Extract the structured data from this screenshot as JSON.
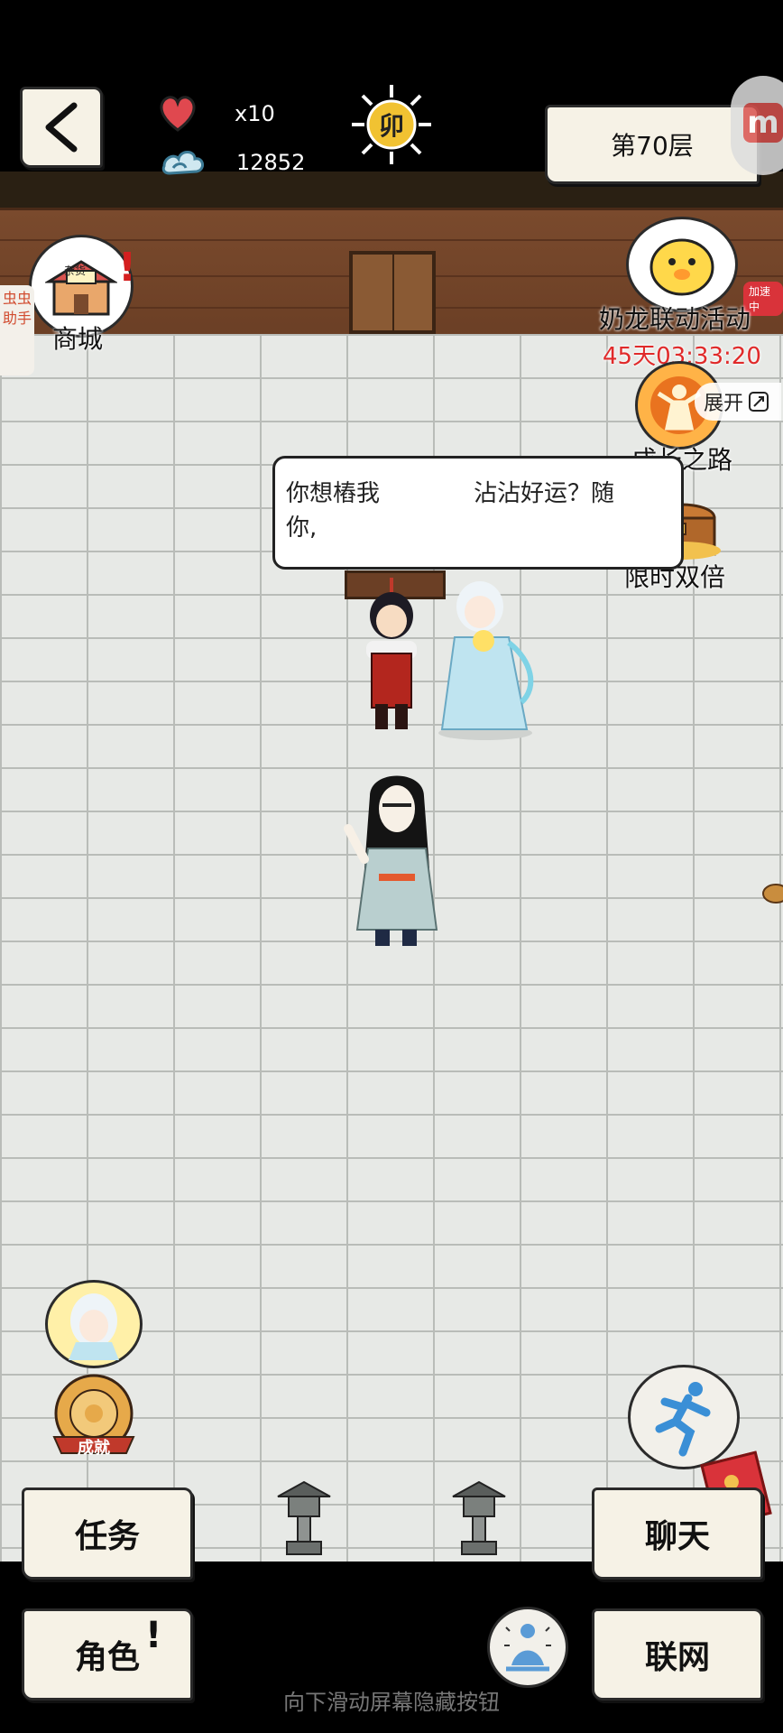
{
  "hud": {
    "lives_label": "x10",
    "score": "12852",
    "time_badge": "卯",
    "floor_label": "第70层"
  },
  "left_menu": {
    "shop_label": "商城",
    "shop_sign": "杂货",
    "helper_label": "虫虫助手"
  },
  "right_menu": {
    "event_label": "奶龙联动活动",
    "event_timer": "45天03:33:20",
    "speed_badge": "加速中",
    "expand_label": "展开",
    "growth_label": "成长之路",
    "double_label": "限时双倍"
  },
  "dialog": {
    "text_line1": "你想樁我　　　　沾沾好运？随",
    "text_line2": "你,"
  },
  "achievement_label": "成就",
  "buttons": {
    "task": "任务",
    "chat": "聊天",
    "role": "角色",
    "network": "联网"
  },
  "footer_hint": "向下滑动屏幕隐藏按钮",
  "colors": {
    "heart": "#e0484f",
    "event_timer": "#e02a2a",
    "wood": "#7a4a2d"
  }
}
